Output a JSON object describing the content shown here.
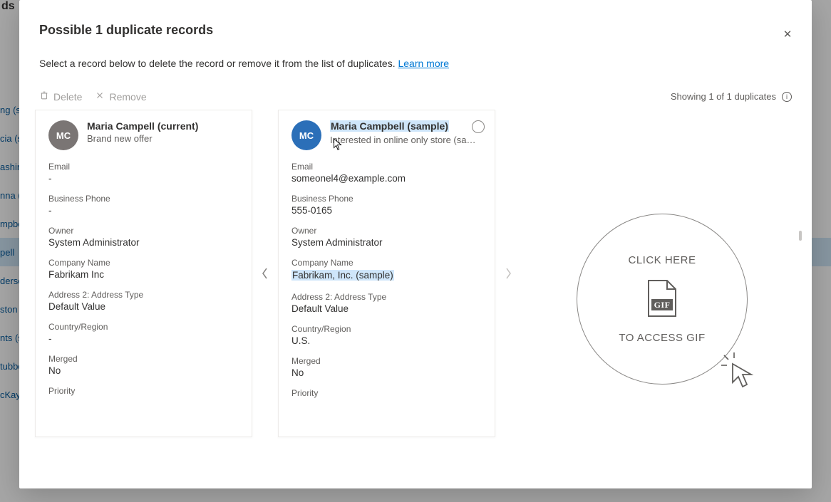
{
  "background": {
    "header_text": "ds",
    "list_items": [
      "ng (s",
      "cia (s",
      "ashing",
      "nna (s",
      "mpbe",
      "pell",
      "dersc",
      "ston",
      "nts (s",
      "tubbe",
      "cKay"
    ],
    "selected_index": 5
  },
  "modal": {
    "title": "Possible 1 duplicate records",
    "subtitle_prefix": "Select a record below to delete the record or remove it from the list of duplicates. ",
    "learn_more": "Learn more",
    "toolbar": {
      "delete_label": "Delete",
      "remove_label": "Remove",
      "status_text": "Showing 1 of 1 duplicates"
    },
    "close_label": "✕"
  },
  "records": {
    "current": {
      "initials": "MC",
      "name": "Maria Campell (current)",
      "subtitle": "Brand new offer",
      "fields": [
        {
          "label": "Email",
          "value": "-"
        },
        {
          "label": "Business Phone",
          "value": "-"
        },
        {
          "label": "Owner",
          "value": "System Administrator"
        },
        {
          "label": "Company Name",
          "value": "Fabrikam Inc"
        },
        {
          "label": "Address 2: Address Type",
          "value": "Default Value"
        },
        {
          "label": "Country/Region",
          "value": "-"
        },
        {
          "label": "Merged",
          "value": "No"
        },
        {
          "label": "Priority",
          "value": ""
        }
      ]
    },
    "duplicate": {
      "initials": "MC",
      "name": "Maria Campbell (sample)",
      "subtitle": "Interested in online only store (sam...",
      "fields": [
        {
          "label": "Email",
          "value": "someonel4@example.com"
        },
        {
          "label": "Business Phone",
          "value": "555-0165"
        },
        {
          "label": "Owner",
          "value": "System Administrator"
        },
        {
          "label": "Company Name",
          "value": "Fabrikam, Inc. (sample)",
          "highlight": true
        },
        {
          "label": "Address 2: Address Type",
          "value": "Default Value"
        },
        {
          "label": "Country/Region",
          "value": "U.S."
        },
        {
          "label": "Merged",
          "value": "No"
        },
        {
          "label": "Priority",
          "value": ""
        }
      ]
    }
  },
  "overlay_circle": {
    "text_top": "CLICK HERE",
    "text_bottom": "TO ACCESS GIF",
    "file_label": "GIF"
  }
}
